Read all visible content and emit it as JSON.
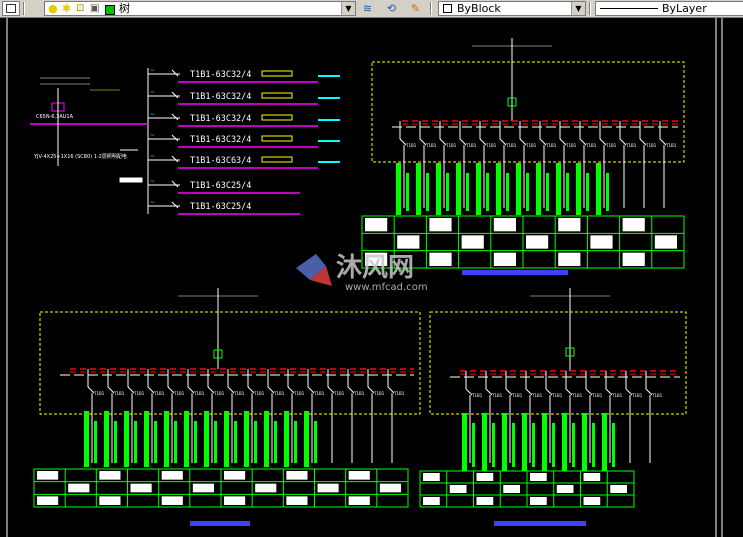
{
  "toolbar": {
    "layer_name": "树",
    "color": "ByBlock",
    "linetype": "ByLayer"
  },
  "drawing": {
    "watermark_brand": "沐风网",
    "watermark_url": "www.mfcad.com",
    "breakers": [
      "T1B1-63C32/4",
      "T1B1-63C32/4",
      "T1B1-63C32/4",
      "T1B1-63C32/4",
      "T1B1-63C63/4",
      "T1B1-63C25/4",
      "T1B1-63C25/4"
    ],
    "notes": {
      "left_label_1": "C65N-6.3AU1A",
      "left_label_2": "YJV-4X25+1X16 (SC80) 1-2层照明配电"
    },
    "colors": {
      "green": "#00ff00",
      "yellow": "#ffff00",
      "magenta": "#ff00ff",
      "cyan": "#00ffff",
      "red": "#ff0000",
      "white": "#ffffff",
      "blue": "#4040ff"
    }
  }
}
